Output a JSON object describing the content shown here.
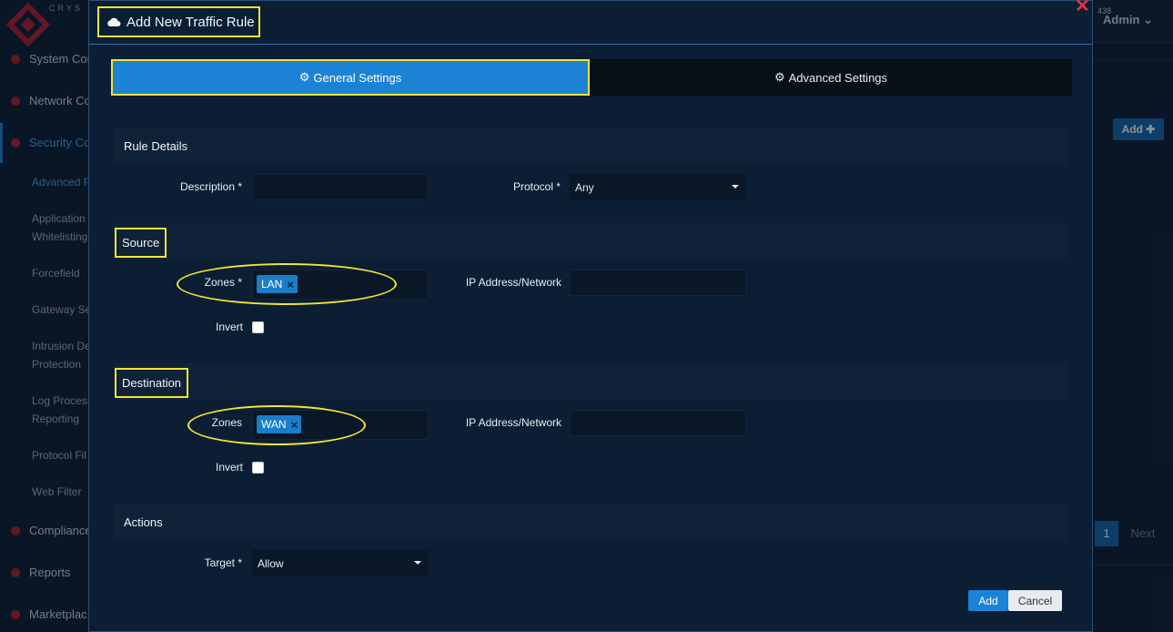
{
  "background": {
    "brand_text": "CRYS",
    "sidebar": [
      {
        "label": "System Con"
      },
      {
        "label": "Network Co"
      },
      {
        "label": "Security Co"
      },
      {
        "label": "Compliance"
      },
      {
        "label": "Reports"
      },
      {
        "label": "Marketplac"
      }
    ],
    "sub_items": [
      "Advanced F",
      "Application",
      "Whitelisting",
      "Forcefield",
      "Gateway Se",
      "Intrusion De",
      "Protection",
      "Log Process",
      "Reporting",
      "Protocol Fil",
      "Web Filter"
    ],
    "admin_label": "Admin",
    "badge_text": "438",
    "add_button": "Add ✚",
    "pagination": {
      "current": "1",
      "next": "Next"
    }
  },
  "modal": {
    "title": "Add New Traffic Rule",
    "tabs": {
      "general": "General Settings",
      "advanced": "Advanced Settings"
    },
    "rule_details": {
      "title": "Rule Details",
      "description_label": "Description *",
      "description_value": "",
      "protocol_label": "Protocol *",
      "protocol_value": "Any"
    },
    "source": {
      "title": "Source",
      "zones_label": "Zones *",
      "zones": [
        "LAN"
      ],
      "ip_label": "IP Address/Network",
      "ip_value": "",
      "invert_label": "Invert"
    },
    "destination": {
      "title": "Destination",
      "zones_label": "Zones",
      "zones": [
        "WAN"
      ],
      "ip_label": "IP Address/Network",
      "ip_value": "",
      "invert_label": "Invert"
    },
    "actions": {
      "title": "Actions",
      "target_label": "Target *",
      "target_value": "Allow"
    },
    "buttons": {
      "add": "Add",
      "cancel": "Cancel"
    }
  },
  "colors": {
    "highlight": "#f3e533",
    "accent": "#1b82d6",
    "close": "#e2333d"
  }
}
